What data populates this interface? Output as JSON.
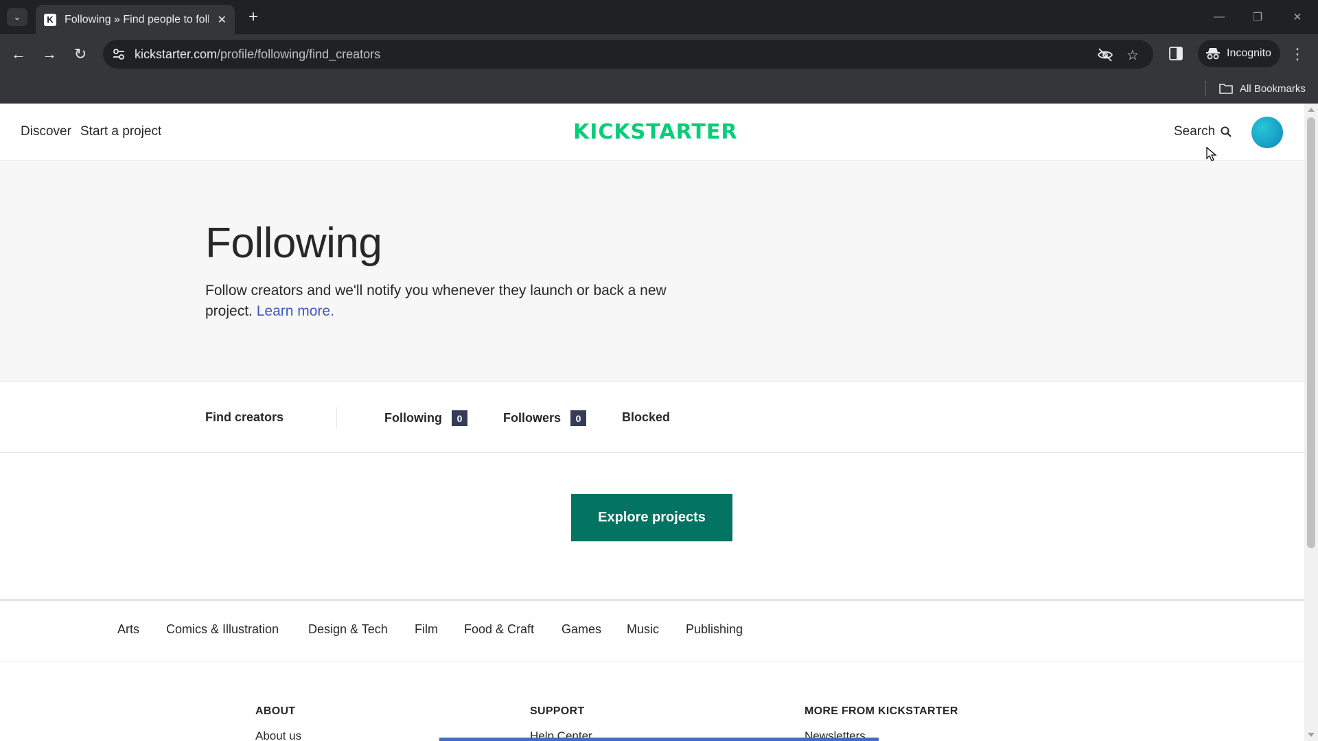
{
  "browser": {
    "tab_title": "Following » Find people to follo",
    "favicon": "K",
    "url_host": "kickstarter.com",
    "url_path": "/profile/following/find_creators",
    "incognito_label": "Incognito",
    "bookmarks_label": "All Bookmarks"
  },
  "header": {
    "discover": "Discover",
    "start_project": "Start a project",
    "logo": "KICKSTARTER",
    "search": "Search"
  },
  "hero": {
    "title": "Following",
    "description": "Follow creators and we'll notify you whenever they launch or back a new project.",
    "learn_more": "Learn more."
  },
  "tabs": {
    "find_creators": "Find creators",
    "following": "Following",
    "following_count": "0",
    "followers": "Followers",
    "followers_count": "0",
    "blocked": "Blocked"
  },
  "cta": {
    "explore": "Explore projects"
  },
  "categories": [
    "Arts",
    "Comics & Illustration",
    "Design & Tech",
    "Film",
    "Food & Craft",
    "Games",
    "Music",
    "Publishing"
  ],
  "footer": {
    "about_heading": "ABOUT",
    "about_link": "About us",
    "support_heading": "SUPPORT",
    "support_link": "Help Center",
    "more_heading": "MORE FROM KICKSTARTER",
    "more_link": "Newsletters"
  },
  "colors": {
    "brand_green": "#05ce78",
    "cta_green": "#037362",
    "link_blue": "#3d5ab5",
    "badge_navy": "#353c57"
  }
}
